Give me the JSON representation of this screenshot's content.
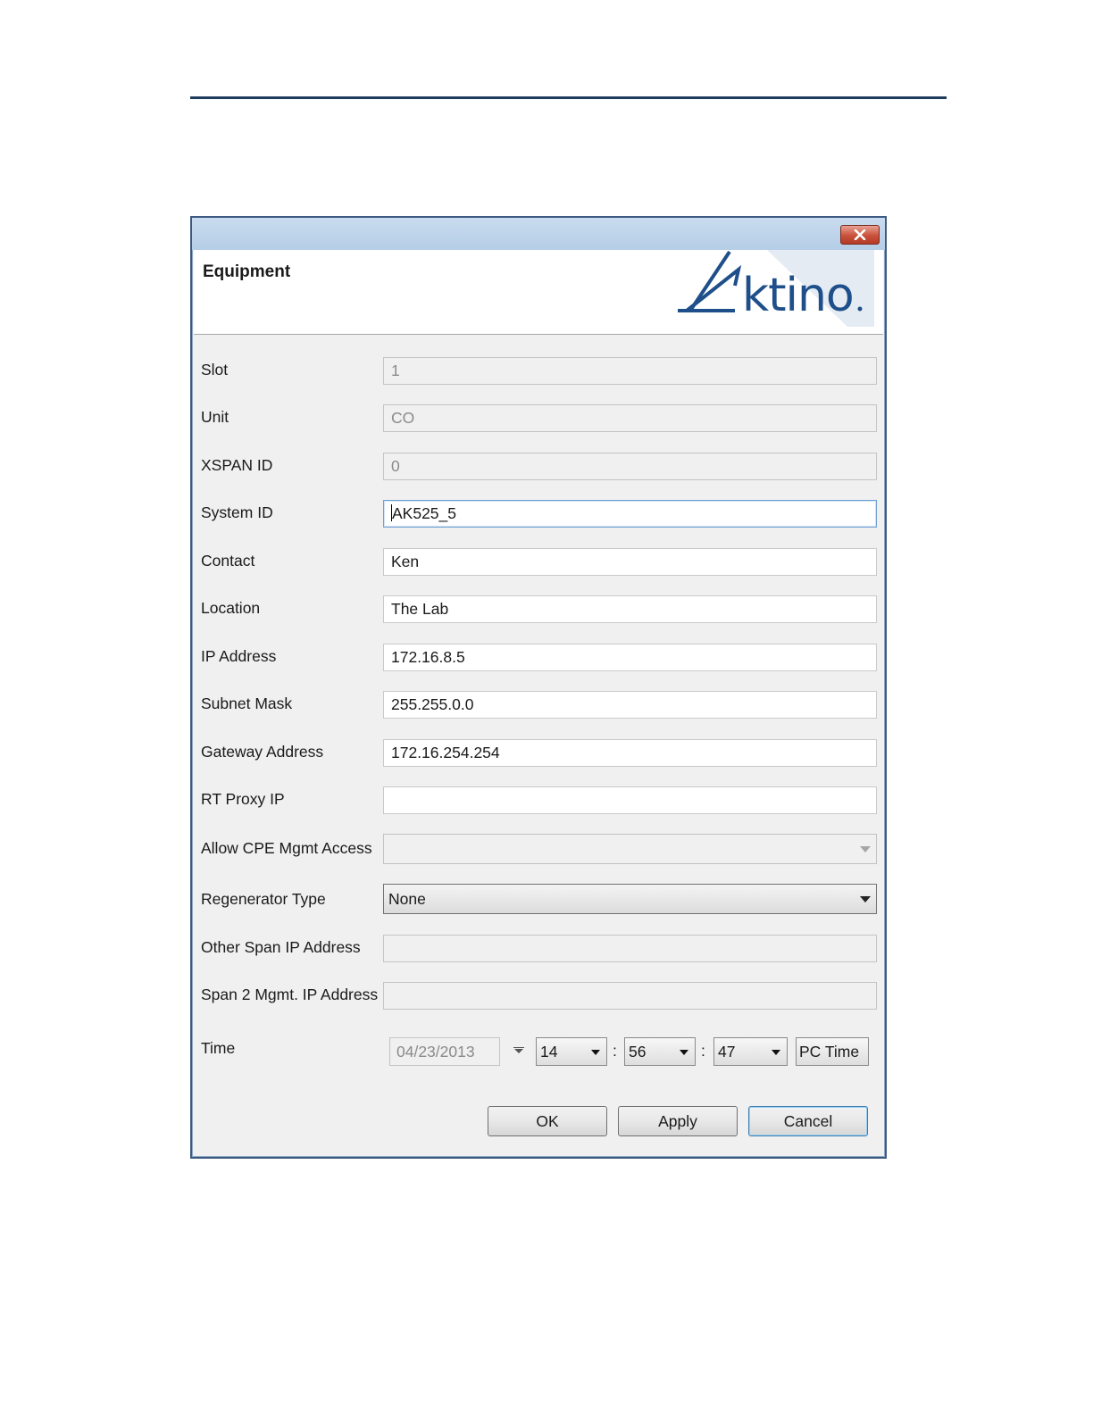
{
  "dialog": {
    "title": "Equipment",
    "logo_text": "Aktino"
  },
  "fields": {
    "slot": {
      "label": "Slot",
      "value": "1"
    },
    "unit": {
      "label": "Unit",
      "value": "CO"
    },
    "xspan_id": {
      "label": "XSPAN ID",
      "value": "0"
    },
    "system_id": {
      "label": "System ID",
      "value": "AK525_5"
    },
    "contact": {
      "label": "Contact",
      "value": "Ken"
    },
    "location": {
      "label": "Location",
      "value": "The Lab"
    },
    "ip_address": {
      "label": "IP Address",
      "value": "172.16.8.5"
    },
    "subnet_mask": {
      "label": "Subnet Mask",
      "value": "255.255.0.0"
    },
    "gateway_address": {
      "label": "Gateway Address",
      "value": "172.16.254.254"
    },
    "rt_proxy_ip": {
      "label": "RT Proxy IP",
      "value": ""
    },
    "allow_cpe_mgmt_access": {
      "label": "Allow CPE Mgmt Access",
      "value": ""
    },
    "regenerator_type": {
      "label": "Regenerator Type",
      "value": "None"
    },
    "other_span_ip_address": {
      "label": "Other Span IP Address",
      "value": ""
    },
    "span2_mgmt_ip_address": {
      "label": "Span 2 Mgmt. IP Address",
      "value": ""
    }
  },
  "time": {
    "label": "Time",
    "date": "04/23/2013",
    "hour": "14",
    "minute": "56",
    "second": "47",
    "separator": ":",
    "pc_time_label": "PC Time"
  },
  "buttons": {
    "ok": "OK",
    "apply": "Apply",
    "cancel": "Cancel"
  },
  "colors": {
    "page_rule": "#1f3b5e",
    "dialog_border": "#3d5a80",
    "close_button": "#c9513b",
    "logo_blue": "#1f4f8a"
  }
}
